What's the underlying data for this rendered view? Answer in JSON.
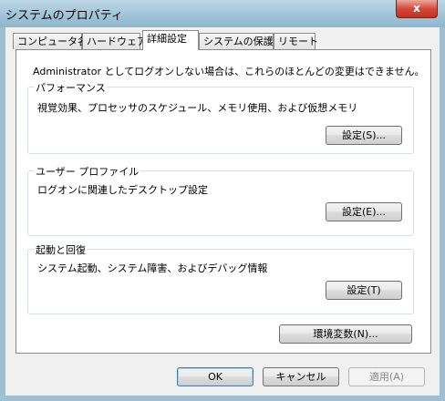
{
  "window": {
    "title": "システムのプロパティ",
    "close_label": "x"
  },
  "tabs": [
    {
      "label": "コンピュータ名"
    },
    {
      "label": "ハードウェア"
    },
    {
      "label": "詳細設定"
    },
    {
      "label": "システムの保護"
    },
    {
      "label": "リモート"
    }
  ],
  "active_tab": "詳細設定",
  "notice": "Administrator としてログオンしない場合は、これらのほとんどの変更はできません。",
  "groups": {
    "performance": {
      "title": "パフォーマンス",
      "desc": "視覚効果、プロセッサのスケジュール、メモリ使用、および仮想メモリ",
      "button": "設定(S)..."
    },
    "user_profile": {
      "title": "ユーザー プロファイル",
      "desc": "ログオンに関連したデスクトップ設定",
      "button": "設定(E)..."
    },
    "startup": {
      "title": "起動と回復",
      "desc": "システム起動、システム障害、およびデバッグ情報",
      "button": "設定(T)"
    }
  },
  "env_button": "環境変数(N)...",
  "footer": {
    "ok": "OK",
    "cancel": "キャンセル",
    "apply": "適用(A)"
  }
}
